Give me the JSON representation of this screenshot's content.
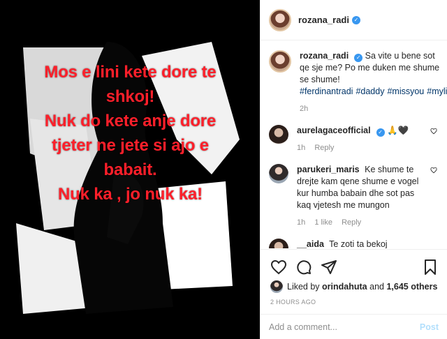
{
  "post": {
    "image_text_lines": [
      "Mos e lini kete dore te",
      "shkoj!",
      "Nuk do kete anje dore",
      "tjeter ne jete si ajo e",
      "babait.",
      "Nuk ka , jo nuk ka!"
    ]
  },
  "header": {
    "username": "rozana_radi",
    "more_icon": "ellipsis-icon"
  },
  "caption": {
    "username": "rozana_radi",
    "text": "Sa vite u bene sot qe sje me? Po me duken me shume se shume!",
    "hashtags": [
      "#ferdinantradi",
      "#daddy",
      "#missyou",
      "#mylife"
    ],
    "time": "2h"
  },
  "comments": [
    {
      "username": "aurelagaceofficial",
      "verified": true,
      "text": "🙏🖤",
      "time": "1h",
      "likes": "",
      "reply": "Reply"
    },
    {
      "username": "parukeri_maris",
      "verified": false,
      "text": "Ke shume te drejte kam qene shume e vogel kur humba babain dhe sot pas kaq vjetesh me mungon",
      "time": "1h",
      "likes": "1 like",
      "reply": "Reply"
    },
    {
      "username": "__aida",
      "text": "Te zoti ta bekoj"
    }
  ],
  "actions": {
    "liked_prefix": "Liked by",
    "liked_user": "orindahuta",
    "liked_and": "and",
    "liked_count": "1,645 others",
    "timestamp": "2 HOURS AGO"
  },
  "add_comment": {
    "placeholder": "Add a comment...",
    "post_label": "Post"
  },
  "colors": {
    "text_red": "#ff1f2a",
    "verified_blue": "#3897f0",
    "hashtag_blue": "#003569",
    "post_disabled": "#b2dffc",
    "muted": "#8e8e8e"
  }
}
